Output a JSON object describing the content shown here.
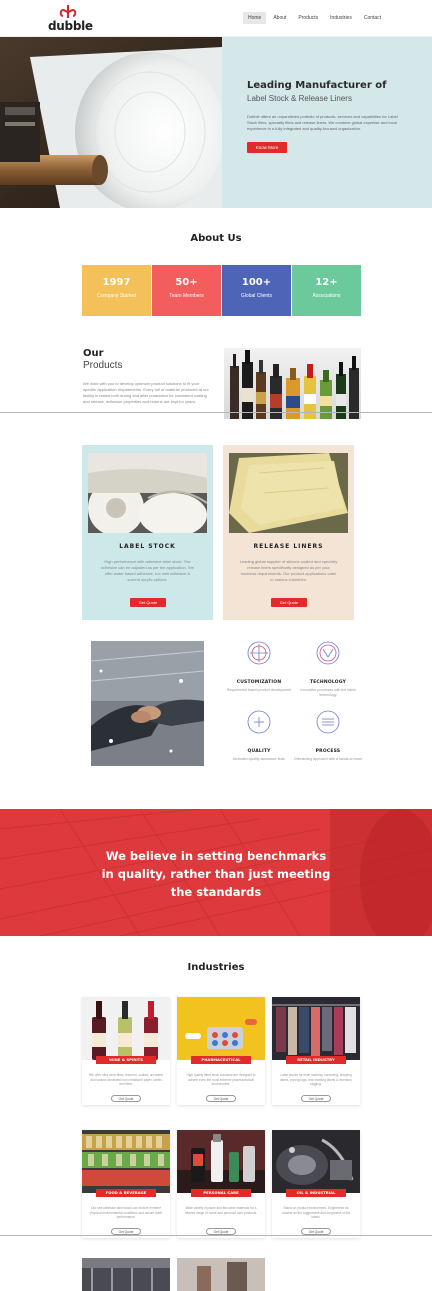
{
  "header": {
    "logo_text": "dubble",
    "nav": [
      "Home",
      "About",
      "Products",
      "Industries",
      "Contact"
    ]
  },
  "hero": {
    "title": "Leading Manufacturer of",
    "subtitle": "Label Stock & Release Liners",
    "description": "Dubble offers an unparalleled portfolio of products, services and capabilities for Label Stock films, specialty films and release liners. We combine global expertise and local experience in a fully integrated and quality-focused organization.",
    "button": "Know More"
  },
  "about": {
    "title": "About Us",
    "stats": [
      {
        "value": "1997",
        "label": "Company Started",
        "color": "#f3c05a"
      },
      {
        "value": "50+",
        "label": "Team Members",
        "color": "#f25d5d"
      },
      {
        "value": "100+",
        "label": "Global Clients",
        "color": "#4d64b7"
      },
      {
        "value": "12+",
        "label": "Associations",
        "color": "#6bc99c"
      }
    ]
  },
  "products": {
    "title_line1": "Our",
    "title_line2": "Products",
    "description": "We work with you to develop optimum product solutions to fit your specific application requirements. Every roll of material produced at our facility is tested both during and after production for consistent coating and release, adhesion properties and returns are kept for years.",
    "cards": [
      {
        "title": "LABEL STOCK",
        "description": "High performance with adhesive label stock. The adhesive can be adjusted as per the application. We offer water based adhesive, hot melt adhesive & solvent acrylic options.",
        "button": "Get Quote",
        "bg": "#cde8e8"
      },
      {
        "title": "RELEASE LINERS",
        "description": "Leading global supplier of silicone coated and specialty release liners specifically designed as per your business requirements. Our product applications cater to various industries.",
        "button": "Get Quote",
        "bg": "#f4e4d6"
      }
    ]
  },
  "features": [
    {
      "title": "CUSTOMIZATION",
      "description": "Requirement based product development",
      "icon": "crosshair-icon"
    },
    {
      "title": "TECHNOLOGY",
      "description": "Innovative processes with the latest technology",
      "icon": "circle-check-icon"
    },
    {
      "title": "QUALITY",
      "description": "Dedicated quality assurance team",
      "icon": "plus-circle-icon"
    },
    {
      "title": "PROCESS",
      "description": "Onboarding approach with a hands-on team",
      "icon": "lines-circle-icon"
    }
  ],
  "banner": {
    "line1": "We believe in setting benchmarks",
    "line2": "in quality, rather than just meeting",
    "line3": "the standards"
  },
  "industries": {
    "title": "Industries",
    "items": [
      {
        "tag": "WINE & SPIRITS",
        "description": "We offer ultra clear films, textured, coated, uncoated and various laminated non metallized paper, labels and films.",
        "button": "Get Quote"
      },
      {
        "tag": "PHARMACEUTICAL",
        "description": "High quality label stock solutions are designed to adhere even the most extreme pharmaceutical environment.",
        "button": "Get Quote"
      },
      {
        "tag": "RETAIL INDUSTRY",
        "description": "Label stocks for shelf marking, barcoding, shipping labels, pricing tags, tear marking labels & inventory tagging.",
        "button": "Get Quote"
      },
      {
        "tag": "FOOD & BEVERAGE",
        "description": "Our self adhesive label stock can endure extreme physical environmental conditions and assure label performance.",
        "button": "Get Quote"
      },
      {
        "tag": "PERSONAL CARE",
        "description": "Wide variety of paper and film label materials for a diverse range of home and personal care products.",
        "button": "Get Quote"
      },
      {
        "tag": "OIL & INDUSTRIAL",
        "description": "Stand on product environment. Engineered as durable as the ruggedness and toughness of the labels.",
        "button": "Get Quote"
      }
    ]
  }
}
